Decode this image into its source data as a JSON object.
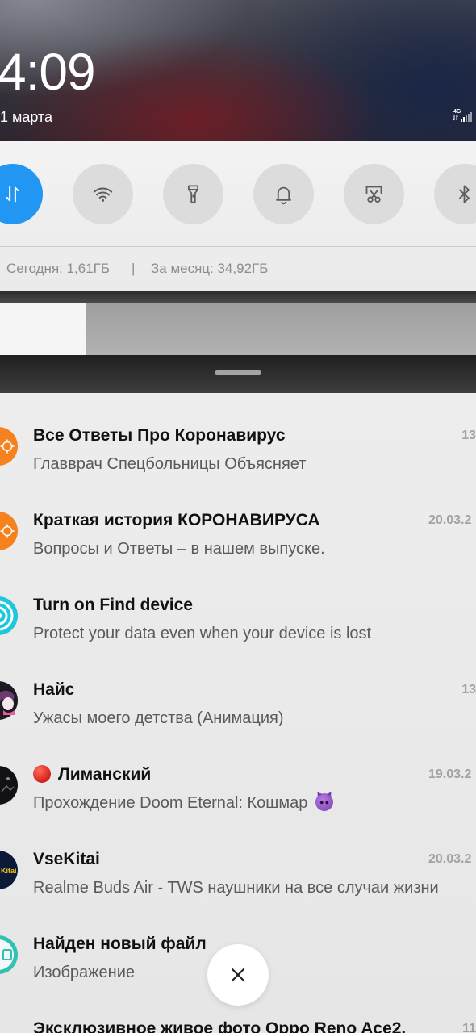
{
  "status": {
    "time": "4:09",
    "date": "1 марта",
    "network": "4G"
  },
  "quick_toggles": [
    {
      "icon": "mobile-data-icon",
      "active": true
    },
    {
      "icon": "wifi-icon",
      "active": false
    },
    {
      "icon": "flashlight-icon",
      "active": false
    },
    {
      "icon": "bell-icon",
      "active": false
    },
    {
      "icon": "screenshot-icon",
      "active": false
    },
    {
      "icon": "bluetooth-icon",
      "active": false
    }
  ],
  "data_usage": {
    "today": "Сегодня: 1,61ГБ",
    "separator": "|",
    "month": "За месяц: 34,92ГБ"
  },
  "brightness": {
    "level": 0.18
  },
  "notifications": [
    {
      "icon": "orange-news-app-icon",
      "title": "Все Ответы Про Коронавирус",
      "text": "Главврач Спецбольницы Объясняет",
      "time": "13"
    },
    {
      "icon": "orange-news-app-icon",
      "title": "Краткая история КОРОНАВИРУСА",
      "text": "Вопросы и Ответы – в нашем выпуске.",
      "time": "20.03.2"
    },
    {
      "icon": "find-device-icon",
      "title": "Turn on Find device",
      "text": "Protect your data even when your device is lost"
    },
    {
      "icon": "channel-avatar-icon",
      "title": "Найс",
      "text": "Ужасы моего детства (Анимация)",
      "time": "13"
    },
    {
      "icon": "channel-avatar-icon",
      "title_emoji": "red-circle-emoji",
      "title": "Лиманский",
      "text": "Прохождение Doom Eternal: Кошмар",
      "text_emoji": "smiling-face-with-horns-emoji",
      "time": "19.03.2"
    },
    {
      "icon": "channel-avatar-icon",
      "icon_text": "Kitai",
      "title": "VseKitai",
      "text": "Realme Buds Air - TWS наушники на все случаи жизни",
      "time": "20.03.2"
    },
    {
      "icon": "file-manager-icon",
      "title": "Найден новый файл",
      "text": "Изображение"
    },
    {
      "title": "Эксклюзивное живое фото Oppo Reno Ace2.",
      "time": "11"
    }
  ],
  "colors": {
    "active_toggle": "#2196f3",
    "news_icon": "#f5821f",
    "find_device_icon": "#1ec7d9",
    "file_icon": "#2fc1b4"
  }
}
